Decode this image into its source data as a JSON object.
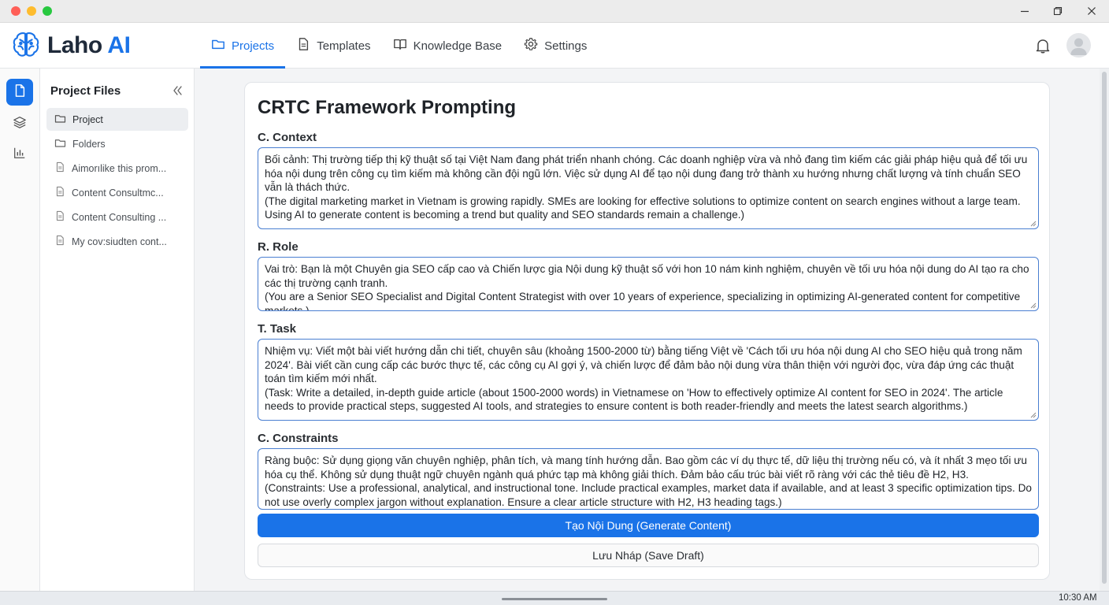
{
  "app": {
    "brand_name": "Laho",
    "brand_suffix": "AI"
  },
  "nav": {
    "items": [
      {
        "label": "Projects",
        "icon": "folder-icon",
        "active": true
      },
      {
        "label": "Templates",
        "icon": "document-icon",
        "active": false
      },
      {
        "label": "Knowledge Base",
        "icon": "book-icon",
        "active": false
      },
      {
        "label": "Settings",
        "icon": "gear-icon",
        "active": false
      }
    ]
  },
  "header": {
    "notification_icon": "bell-icon",
    "avatar_icon": "user-avatar"
  },
  "rail": {
    "items": [
      {
        "icon": "file-icon",
        "active": true
      },
      {
        "icon": "layers-icon",
        "active": false
      },
      {
        "icon": "bar-chart-icon",
        "active": false
      }
    ]
  },
  "files": {
    "title": "Project Files",
    "items": [
      {
        "label": "Project",
        "icon": "folder-icon",
        "selected": true
      },
      {
        "label": "Folders",
        "icon": "folder-icon",
        "selected": false
      },
      {
        "label": "Aimorılike this prom...",
        "icon": "doc-icon",
        "selected": false
      },
      {
        "label": "Content Consultmc...",
        "icon": "doc-icon",
        "selected": false
      },
      {
        "label": "Content Consulting ...",
        "icon": "doc-icon",
        "selected": false
      },
      {
        "label": "My cov:siudten cont...",
        "icon": "doc-icon",
        "selected": false
      }
    ]
  },
  "editor": {
    "title": "CRTC Framework Prompting",
    "sections": [
      {
        "label": "C. Context",
        "lines": [
          "Bối cảnh: Thị trường tiếp thị kỹ thuật số tại Việt Nam đang phát triển nhanh chóng. Các doanh nghiệp vừa và nhỏ đang tìm kiếm các giải pháp hiệu quả để tối ưu hóa nội dung trên công cụ tìm kiếm mà không cần đội ngũ lớn. Việc sử dụng AI để tạo nội dung đang trở thành xu hướng nhưng chất lượng và tính chuẩn SEO vẫn là thách thức.",
          "(The digital marketing market in Vietnam is growing rapidly. SMEs are looking for effective solutions to optimize content on search engines without a large team. Using AI to generate content is becoming a trend but quality and SEO standards remain a challenge.)"
        ]
      },
      {
        "label": "R. Role",
        "lines": [
          "Vai trò: Bạn là một Chuyên gia SEO cấp cao và Chiến lược gia Nội dung kỹ thuật số với hon 10 nám kinh nghiệm, chuyên về tối ưu hóa nội dung do AI tạo ra cho các thị trường cạnh tranh.",
          "(You are a Senior SEO Specialist and Digital Content Strategist with over 10 years of experience, specializing in optimizing AI-generated content for competitive markets.)"
        ]
      },
      {
        "label": "T. Task",
        "lines": [
          "Nhiệm vụ: Viết một bài viết hướng dẫn chi tiết, chuyên sâu (khoảng 1500-2000 từ) bằng tiếng Việt về 'Cách tối ưu hóa nội dung AI cho SEO hiệu quả trong năm 2024'. Bài viết cần cung cấp các bước thực tế, các công cụ AI gợi ý, và chiến lược để đảm bảo nội dung vừa thân thiện với người đọc, vừa đáp ứng các thuật toán tìm kiếm mới nhất.",
          "(Task: Write a detailed, in-depth guide article (about 1500-2000 words) in Vietnamese on 'How to effectively optimize AI content for SEO in 2024'. The article needs to provide practical steps, suggested AI tools, and strategies to ensure content is both reader-friendly and meets the latest search algorithms.)"
        ]
      },
      {
        "label": "C. Constraints",
        "lines": [
          "Ràng buộc: Sử dụng giọng văn chuyên nghiệp, phân tích, và mang tính hướng dẫn. Bao gồm các ví dụ thực tế, dữ liệu thị trường nếu có, và ít nhất 3 mẹo tối ưu hóa cụ thể. Không sử dụng thuật ngữ chuyên ngành quá phức tạp mà không giải thích. Đảm bảo cấu trúc bài viết rõ ràng với các thẻ tiêu đề H2, H3.",
          "(Constraints: Use a professional, analytical, and instructional tone. Include practical examples, market data if available, and at least 3 specific optimization tips. Do not use overly complex jargon without explanation. Ensure a clear article structure with H2, H3 heading tags.)"
        ]
      }
    ],
    "generate_label": "Tạo Nội Dung (Generate Content)",
    "save_label": "Lưu Nháp (Save Draft)"
  },
  "taskbar": {
    "time": "10:30 AM"
  },
  "colors": {
    "accent": "#1a73e8",
    "brand_dark": "#1f2a3a"
  }
}
